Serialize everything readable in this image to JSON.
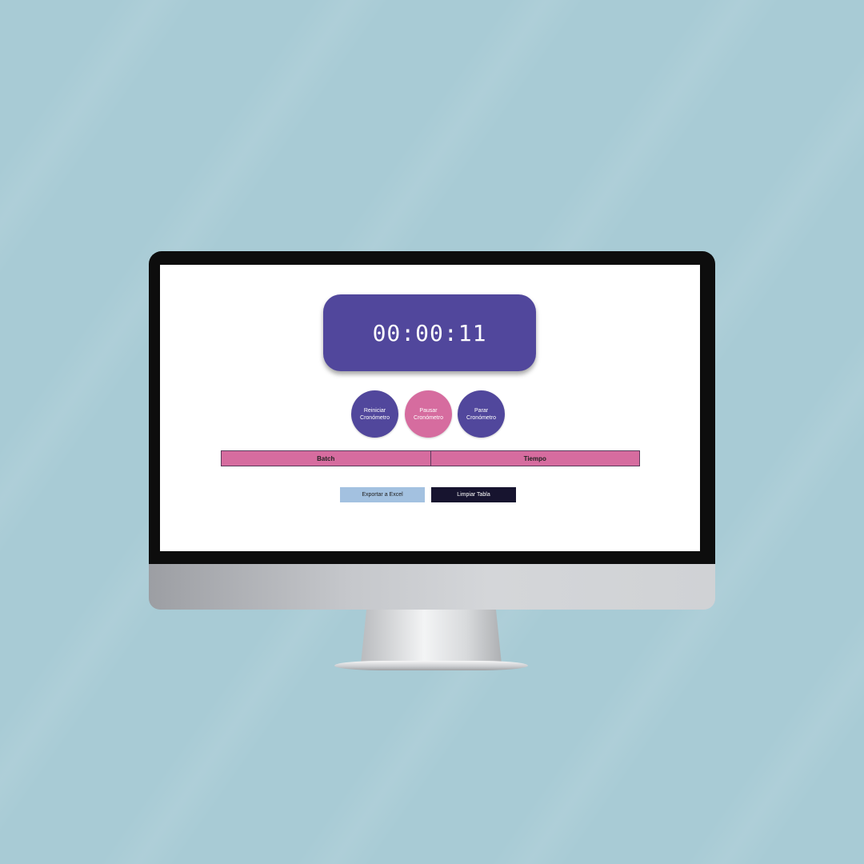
{
  "timer": {
    "display": "00:00:11"
  },
  "controls": {
    "reset_label": "Reiniciar Cronómetro",
    "pause_label": "Pausar Cronómetro",
    "stop_label": "Parar Cronómetro"
  },
  "table": {
    "columns": [
      "Batch",
      "Tiempo"
    ]
  },
  "actions": {
    "export_label": "Exportar a Excel",
    "clear_label": "Limpiar Tabla"
  },
  "colors": {
    "background": "#a8cbd5",
    "timer_bg": "#51479c",
    "accent_pink": "#d66c9f",
    "export_bg": "#a3c1e0",
    "clear_bg": "#17142f"
  }
}
